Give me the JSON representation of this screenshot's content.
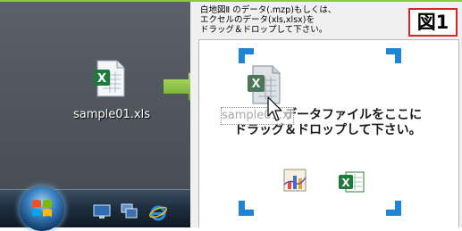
{
  "desktop": {
    "file_name": "sample01.xls"
  },
  "app": {
    "instruction_line1": "白地図Ⅱ のデータ(.mzp)もしくは、",
    "instruction_line2": "エクセルのデータ(xls,xlsx)を",
    "instruction_line3": "ドラッグ＆ドロップして下さい。",
    "figure_label": "図1",
    "drop_message_line1": "データファイルをここに",
    "drop_message_line2": "ドラッグ＆ドロップして下さい。",
    "drag_ghost_label": "sample01.xls"
  },
  "icons": {
    "file": "excel-file-icon",
    "arrow": "green-arrow-icon",
    "start": "windows-start-orb",
    "taskbar": [
      "show-desktop-icon",
      "switch-windows-icon",
      "internet-explorer-icon"
    ],
    "drop_apps": [
      "map-chart-app-icon",
      "excel-app-icon"
    ]
  },
  "colors": {
    "accent_blue": "#1f83d6",
    "figure_border": "#d8232a",
    "arrow_green": "#8dc63f"
  }
}
